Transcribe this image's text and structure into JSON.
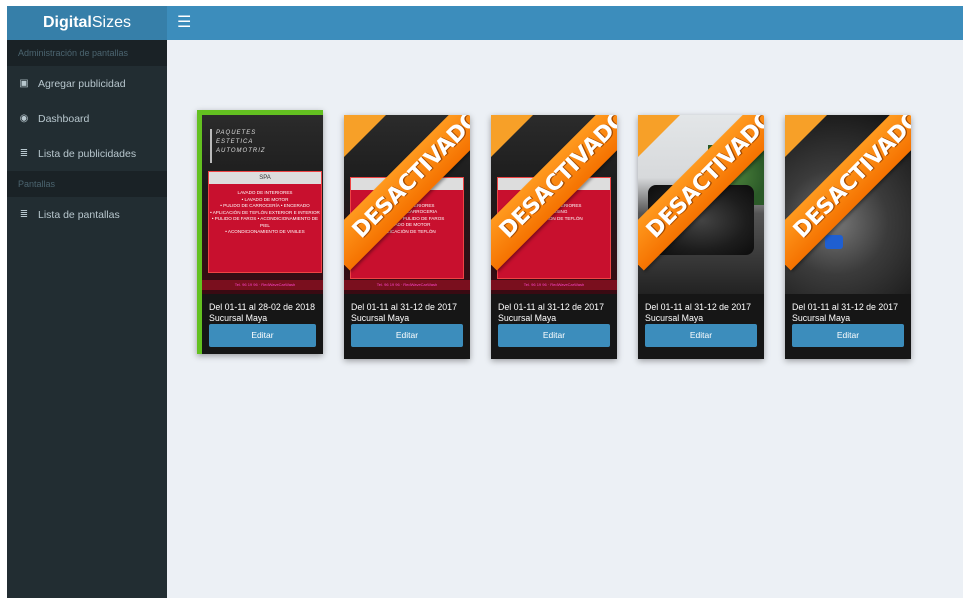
{
  "brand": {
    "bold": "Digital",
    "rest": "Sizes"
  },
  "topbar": {
    "menu_icon": "☰"
  },
  "sidebar": {
    "section1": "Administración de pantallas",
    "items1": [
      {
        "label": "Agregar publicidad",
        "icon": "calendar-plus-icon",
        "glyph": "▣"
      },
      {
        "label": "Dashboard",
        "icon": "dashboard-icon",
        "glyph": "◉"
      },
      {
        "label": "Lista de publicidades",
        "icon": "list-icon",
        "glyph": "≣"
      }
    ],
    "section2": "Pantallas",
    "items2": [
      {
        "label": "Lista de pantallas",
        "icon": "list-icon",
        "glyph": "≣"
      }
    ]
  },
  "cards": [
    {
      "dates": "Del 01-11 al 28-02 de 2018",
      "branch": "Sucursal Maya",
      "edit": "Editar",
      "status": "active",
      "ribbon": ""
    },
    {
      "dates": "Del 01-11 al 31-12 de 2017",
      "branch": "Sucursal Maya",
      "edit": "Editar",
      "status": "inactive",
      "ribbon": "DESACTIVADO"
    },
    {
      "dates": "Del 01-11 al 31-12 de 2017",
      "branch": "Sucursal Maya",
      "edit": "Editar",
      "status": "inactive",
      "ribbon": "DESACTIVADO"
    },
    {
      "dates": "Del 01-11 al 31-12 de 2017",
      "branch": "Sucursal Maya",
      "edit": "Editar",
      "status": "inactive",
      "ribbon": "DESACTIVADO"
    },
    {
      "dates": "Del 01-11 al 31-12 de 2017",
      "branch": "Sucursal Maya",
      "edit": "Editar",
      "status": "inactive",
      "ribbon": "DESACTIVADO"
    }
  ],
  "colors": {
    "header": "#3c8dbc",
    "logo": "#367fa9",
    "sidebar": "#222d32",
    "active_border": "#63c020",
    "ribbon": "#f57200"
  }
}
